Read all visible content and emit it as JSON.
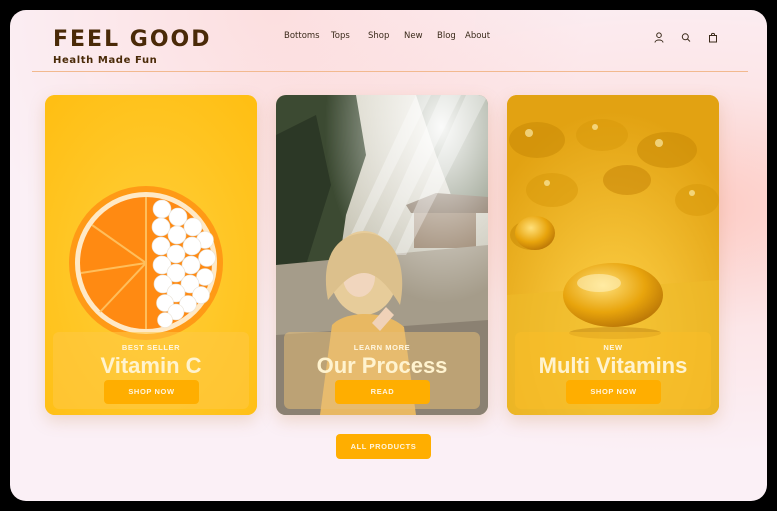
{
  "brand": {
    "name": "FEEL GOOD",
    "tagline": "Health Made Fun"
  },
  "nav": {
    "items": [
      {
        "label": "Bottoms"
      },
      {
        "label": "Tops"
      },
      {
        "label": "Shop"
      },
      {
        "label": "New"
      },
      {
        "label": "Blog"
      },
      {
        "label": "About"
      }
    ],
    "icons": [
      "user-icon",
      "search-icon",
      "bag-icon"
    ]
  },
  "cards": [
    {
      "kicker": "BEST SELLER",
      "title": "Vitamin C",
      "button": "SHOP NOW",
      "image": "orange-with-pills"
    },
    {
      "kicker": "LEARN MORE",
      "title": "Our Process",
      "button": "READ",
      "image": "smiling-woman-in-sunlit-forest"
    },
    {
      "kicker": "NEW",
      "title": "Multi Vitamins",
      "button": "SHOP NOW",
      "image": "golden-softgel-capsules"
    }
  ],
  "all_products": "ALL PRODUCTS",
  "colors": {
    "brand_text": "#4a2a08",
    "accent_button": "#ffae00",
    "card_yellow": "#ffc21c",
    "header_rule": "#f2b98f"
  }
}
